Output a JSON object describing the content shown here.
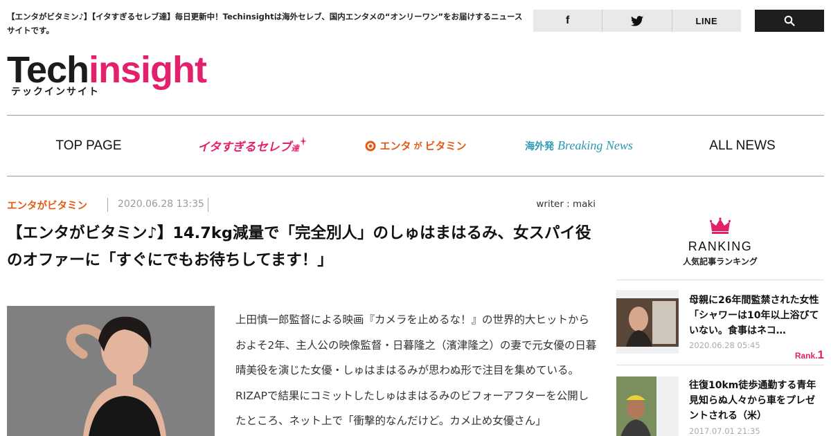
{
  "header": {
    "tagline": "【エンタがビタミン♪】【イタすぎるセレブ達】毎日更新中！Techinsightは海外セレブ、国内エンタメの“オンリーワン”をお届けするニュースサイトです。",
    "social": {
      "facebook": "f",
      "line": "LINE"
    },
    "logo": {
      "tech": "Tech",
      "insight": "insight",
      "kana": "テックインサイト"
    }
  },
  "nav": {
    "top_page": "TOP PAGE",
    "celeb": "イタすぎるセレブ",
    "celeb_suffix": "達",
    "vitamin": "エンタ",
    "vitamin_mid": "が",
    "vitamin_end": "ビタミン",
    "breaking_jp": "海外発",
    "breaking_en": "Breaking News",
    "all_news": "ALL NEWS"
  },
  "article": {
    "category": "エンタがビタミン",
    "date": "2020.06.28 13:35",
    "writer": "writer : maki",
    "title": "【エンタがビタミン♪】14.7kg減量で「完全別人」のしゅはまはるみ、女スパイ役のオファーに「すぐにでもお待ちしてます！」",
    "body": "上田慎一郎監督による映画『カメラを止めるな！』の世界的大ヒットからおよそ2年、主人公の映像監督・日暮隆之（濱津隆之）の妻で元女優の日暮晴美役を演じた女優・しゅはまはるみが思わぬ形で注目を集めている。RIZAPで結果にコミットしたしゅはまはるみのビフォーアフターを公開したところ、ネット上で「衝撃的なんだけど。カメ止め女優さん」"
  },
  "ranking": {
    "title": "RANKING",
    "subtitle": "人気記事ランキング",
    "items": [
      {
        "title": "母親に26年間監禁された女性「シャワーは10年以上浴びていない。食事はネコ…",
        "date": "2020.06.28 05:45",
        "rank_label": "Rank.",
        "rank_num": "1"
      },
      {
        "title": "往復10km徒歩通勤する青年　見知らぬ人々から車をプレゼントされる（米）",
        "date": "2017.07.01 21:35"
      }
    ]
  },
  "colors": {
    "accent_pink": "#e3206c",
    "accent_orange": "#e35a15",
    "accent_teal": "#2b98b5",
    "dark": "#1e1e1e"
  }
}
